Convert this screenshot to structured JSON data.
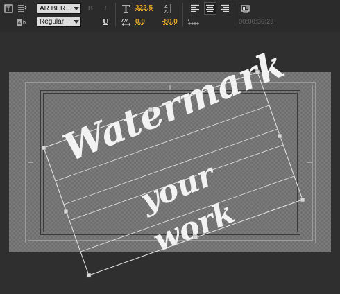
{
  "toolbar": {
    "font_family_value": "AR BER...",
    "font_style_value": "Regular",
    "bold_label": "B",
    "italic_label": "I",
    "underline_label": "U",
    "font_size_value": "322.5",
    "kerning_value": "0.0",
    "leading_value": "-80.0",
    "timecode": "00:00:36:23",
    "icons": [
      "text-box-icon",
      "text-columns-icon",
      "font-preview-icon",
      "font-size-icon",
      "kerning-icon",
      "leading-icon",
      "baseline-icon",
      "tab-stops-icon",
      "align-left-icon",
      "align-center-icon",
      "align-right-icon",
      "playhead-frame-icon"
    ]
  },
  "title": {
    "lines": [
      "Watermark",
      "your",
      "work"
    ],
    "text_color": "#f2f2f2",
    "value_color": "#e2a52a"
  }
}
